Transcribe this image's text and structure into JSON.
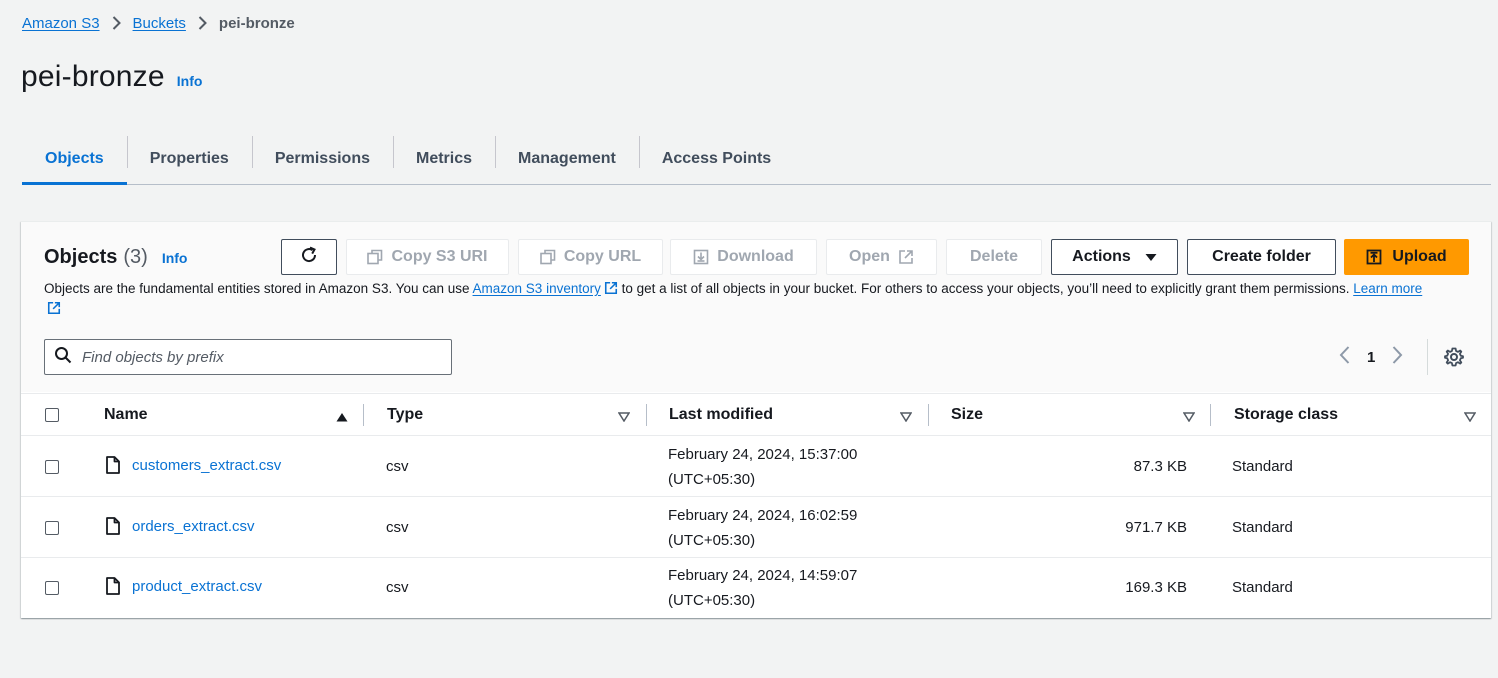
{
  "breadcrumb": {
    "items": [
      "Amazon S3",
      "Buckets"
    ],
    "current": "pei-bronze"
  },
  "header": {
    "title": "pei-bronze",
    "info": "Info"
  },
  "tabs": [
    {
      "label": "Objects",
      "active": true
    },
    {
      "label": "Properties",
      "active": false
    },
    {
      "label": "Permissions",
      "active": false
    },
    {
      "label": "Metrics",
      "active": false
    },
    {
      "label": "Management",
      "active": false
    },
    {
      "label": "Access Points",
      "active": false
    }
  ],
  "objects_panel": {
    "title": "Objects",
    "count": "(3)",
    "info": "Info",
    "buttons": {
      "copy_s3_uri": "Copy S3 URI",
      "copy_url": "Copy URL",
      "download": "Download",
      "open": "Open",
      "delete": "Delete",
      "actions": "Actions",
      "create_folder": "Create folder",
      "upload": "Upload"
    },
    "description": {
      "part1": "Objects are the fundamental entities stored in Amazon S3. You can use ",
      "inventory_link": "Amazon S3 inventory",
      "part2": " to get a list of all objects in your bucket. For others to access your objects, you’ll need to explicitly grant them permissions. ",
      "learn_more": "Learn more"
    },
    "search": {
      "placeholder": "Find objects by prefix",
      "value": ""
    },
    "pagination": {
      "current_page": "1"
    }
  },
  "table": {
    "columns": [
      "Name",
      "Type",
      "Last modified",
      "Size",
      "Storage class"
    ],
    "rows": [
      {
        "name": "customers_extract.csv",
        "type": "csv",
        "modified_date": "February 24, 2024, 15:37:00",
        "modified_tz": "(UTC+05:30)",
        "size": "87.3 KB",
        "storage_class": "Standard"
      },
      {
        "name": "orders_extract.csv",
        "type": "csv",
        "modified_date": "February 24, 2024, 16:02:59",
        "modified_tz": "(UTC+05:30)",
        "size": "971.7 KB",
        "storage_class": "Standard"
      },
      {
        "name": "product_extract.csv",
        "type": "csv",
        "modified_date": "February 24, 2024, 14:59:07",
        "modified_tz": "(UTC+05:30)",
        "size": "169.3 KB",
        "storage_class": "Standard"
      }
    ]
  },
  "colors": {
    "link": "#0972d3",
    "primary_button": "#ff9900",
    "page_background": "#f2f3f3",
    "text": "#16191f",
    "disabled_text": "#a0a7b0"
  },
  "icons": {
    "breadcrumb_separator": "chevron-right-icon",
    "refresh": "refresh-icon",
    "copy": "copy-icon",
    "download": "download-icon",
    "external": "external-link-icon",
    "dropdown": "caret-down-icon",
    "upload": "upload-icon",
    "search": "search-icon",
    "pager_prev": "chevron-left-icon",
    "pager_next": "chevron-right-icon",
    "settings": "gear-icon",
    "file": "file-icon",
    "sort_asc": "sort-ascending-icon",
    "sort": "sort-caret-icon"
  }
}
